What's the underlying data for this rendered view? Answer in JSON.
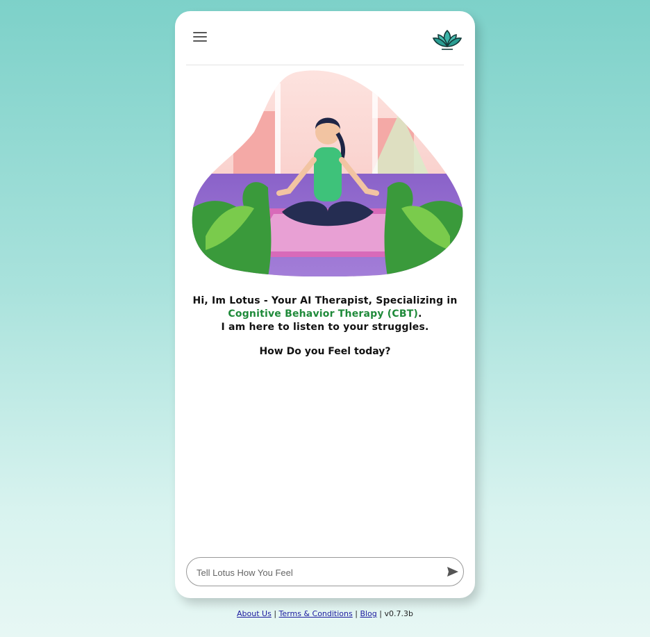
{
  "header": {
    "menu_icon": "hamburger-menu-icon",
    "logo_icon": "lotus-logo-icon"
  },
  "hero": {
    "image": "meditating-woman-illustration"
  },
  "intro": {
    "line1": "Hi, Im Lotus - Your AI Therapist, Specializing in",
    "cbt": "Cognitive Behavior Therapy (CBT)",
    "cbt_suffix": ".",
    "line3": "I am here to listen to your struggles.",
    "question": "How Do you Feel today?"
  },
  "chat_input": {
    "placeholder": "Tell Lotus How You Feel",
    "value": "",
    "send_icon": "send-icon"
  },
  "footer": {
    "about": "About Us",
    "sep1": "|",
    "terms": "Terms & Conditions",
    "sep2": "|",
    "blog": "Blog",
    "sep3": "|",
    "version": "v0.7.3b"
  },
  "colors": {
    "accent_green": "#1f8a3a",
    "teal": "#3bb3a8",
    "link": "#1a1a9e"
  }
}
